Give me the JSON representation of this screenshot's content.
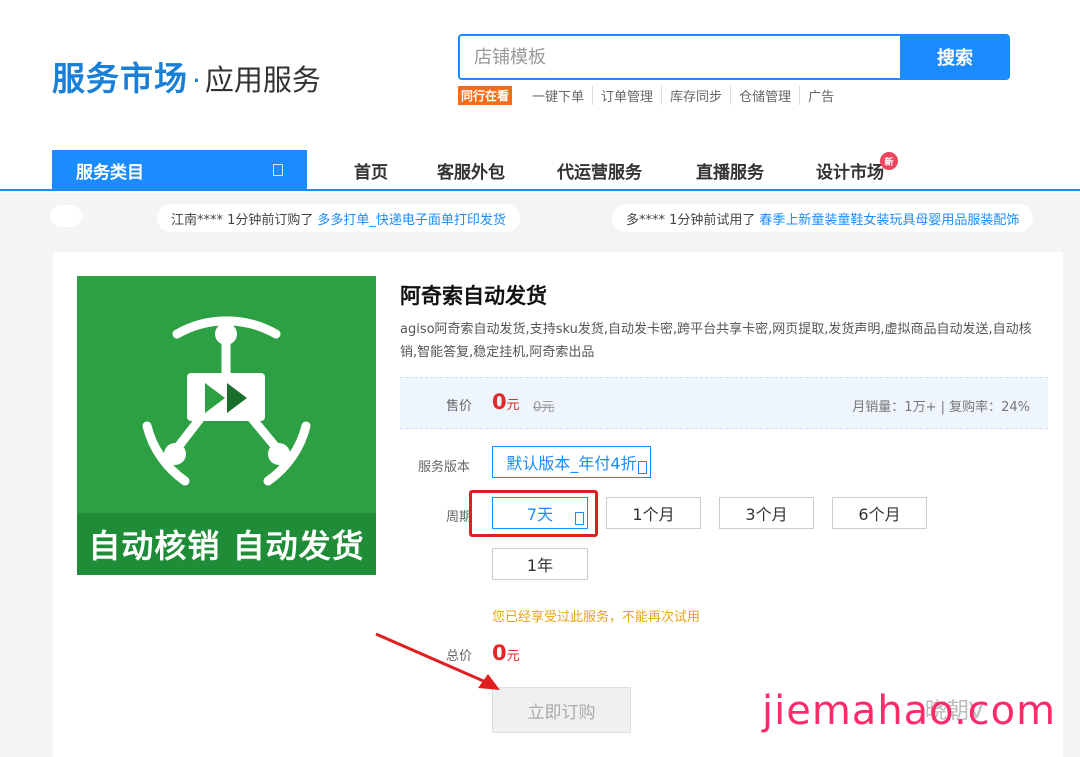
{
  "header": {
    "logo_main": "服务市场",
    "logo_dot": "·",
    "logo_sub": "应用服务",
    "search_placeholder": "店铺模板",
    "search_button": "搜索",
    "hot_badge": "同行在看",
    "hot_links": [
      "一键下单",
      "订单管理",
      "库存同步",
      "仓储管理",
      "广告"
    ]
  },
  "nav": {
    "category_label": "服务类目",
    "items": [
      "首页",
      "客服外包",
      "代运营服务",
      "直播服务",
      "设计市场"
    ],
    "new_badge": "新"
  },
  "ticker": {
    "item1_user": "江南**** 1分钟前订购了",
    "item1_link": "多多打单_快递电子面单打印发货",
    "item2_user": "多**** 1分钟前试用了",
    "item2_link": "春季上新童装童鞋女装玩具母婴用品服装配饰"
  },
  "product": {
    "image_banner": "自动核销 自动发货",
    "title": "阿奇索自动发货",
    "description": "agiso阿奇索自动发货,支持sku发货,自动发卡密,跨平台共享卡密,网页提取,发货声明,虚拟商品自动发送,自动核销,智能答复,稳定挂机,阿奇索出品",
    "price_label": "售价",
    "price_value": "0",
    "price_unit": "元",
    "price_original": "0元",
    "stats": "月销量：1万+ | 复购率：24%",
    "version_label": "服务版本",
    "version_selected": "默认版本_年付4折",
    "period_label": "周期",
    "periods": [
      "7天",
      "1个月",
      "3个月",
      "6个月",
      "1年"
    ],
    "selected_period": "7天",
    "warning": "您已经享受过此服务，不能再次试用",
    "total_label": "总价",
    "total_value": "0",
    "total_unit": "元",
    "buy_button": "立即订购"
  },
  "overlay": {
    "watermark": "jiemahao.com",
    "wechat_mark": "晓朝V"
  },
  "colors": {
    "brand_blue": "#1a8cff",
    "price_red": "#e02a2a",
    "product_green": "#2da044",
    "warn_yellow": "#e8a417",
    "watermark_pink": "#ff2a6a"
  }
}
